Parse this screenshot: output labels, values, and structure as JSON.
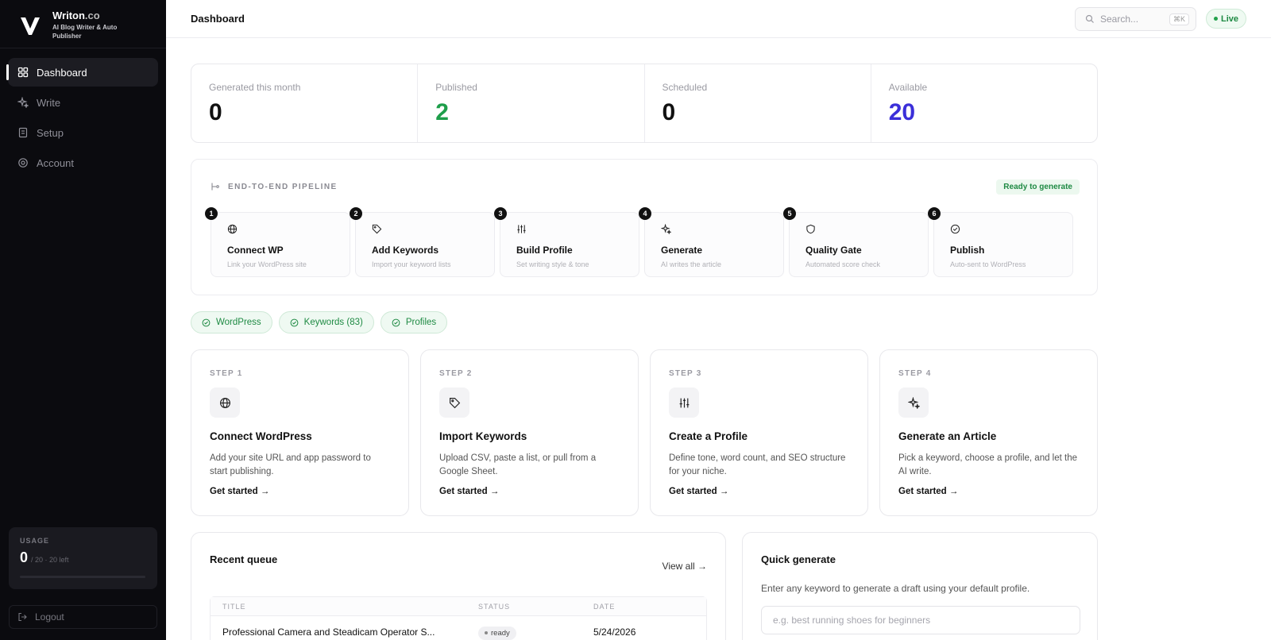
{
  "brand": {
    "name": "Writon",
    "suffix": ".co",
    "tagline": "AI Blog Writer & Auto Publisher"
  },
  "sidebar": {
    "items": [
      {
        "label": "Dashboard",
        "icon": "dashboard-icon",
        "active": true
      },
      {
        "label": "Write",
        "icon": "sparkle-icon"
      },
      {
        "label": "Setup",
        "icon": "setup-icon"
      },
      {
        "label": "Account",
        "icon": "gear-icon"
      }
    ],
    "usage": {
      "label": "USAGE",
      "value": "0",
      "detail": "/ 20 · 20 left",
      "fraction": 0
    },
    "logout": "Logout"
  },
  "header": {
    "title": "Dashboard",
    "search_placeholder": "Search...",
    "shortcut": "⌘K",
    "status": "Live"
  },
  "stats": [
    {
      "label": "Generated this month",
      "value": "0"
    },
    {
      "label": "Published",
      "value": "2"
    },
    {
      "label": "Scheduled",
      "value": "0"
    },
    {
      "label": "Available",
      "value": "20"
    }
  ],
  "pipeline": {
    "heading": "END-TO-END PIPELINE",
    "badge": "Ready to generate",
    "steps": [
      {
        "num": "1",
        "title": "Connect WP",
        "desc": "Link your WordPress site",
        "icon": "globe-icon"
      },
      {
        "num": "2",
        "title": "Add Keywords",
        "desc": "Import your keyword lists",
        "icon": "tag-icon"
      },
      {
        "num": "3",
        "title": "Build Profile",
        "desc": "Set writing style & tone",
        "icon": "sliders-icon"
      },
      {
        "num": "4",
        "title": "Generate",
        "desc": "AI writes the article",
        "icon": "sparkle-icon"
      },
      {
        "num": "5",
        "title": "Quality Gate",
        "desc": "Automated score check",
        "icon": "shield-icon"
      },
      {
        "num": "6",
        "title": "Publish",
        "desc": "Auto-sent to WordPress",
        "icon": "check-circle-icon"
      }
    ]
  },
  "chips": [
    "WordPress",
    "Keywords (83)",
    "Profiles"
  ],
  "onboarding": [
    {
      "step": "STEP 1",
      "title": "Connect WordPress",
      "desc": "Add your site URL and app password to start publishing.",
      "link": "Get started →",
      "icon": "globe-icon"
    },
    {
      "step": "STEP 2",
      "title": "Import Keywords",
      "desc": "Upload CSV, paste a list, or pull from a Google Sheet.",
      "link": "Get started →",
      "icon": "tag-icon"
    },
    {
      "step": "STEP 3",
      "title": "Create a Profile",
      "desc": "Define tone, word count, and SEO structure for your niche.",
      "link": "Get started →",
      "icon": "sliders-icon"
    },
    {
      "step": "STEP 4",
      "title": "Generate an Article",
      "desc": "Pick a keyword, choose a profile, and let the AI write.",
      "link": "Get started →",
      "icon": "sparkle-icon"
    }
  ],
  "queue": {
    "title": "Recent queue",
    "view_all": "View all →",
    "columns": [
      "TITLE",
      "STATUS",
      "DATE"
    ],
    "rows": [
      {
        "title": "Professional Camera and Steadicam Operator S...",
        "status": "ready",
        "date": "5/24/2026"
      }
    ]
  },
  "quick": {
    "title": "Quick generate",
    "desc": "Enter any keyword to generate a draft using your default profile.",
    "placeholder": "e.g. best running shoes for beginners"
  },
  "colors": {
    "published": "#1e9e4a",
    "available": "#3b2fd9",
    "sidebar_bg": "#0b0b0f",
    "success": "#1e8a43"
  }
}
